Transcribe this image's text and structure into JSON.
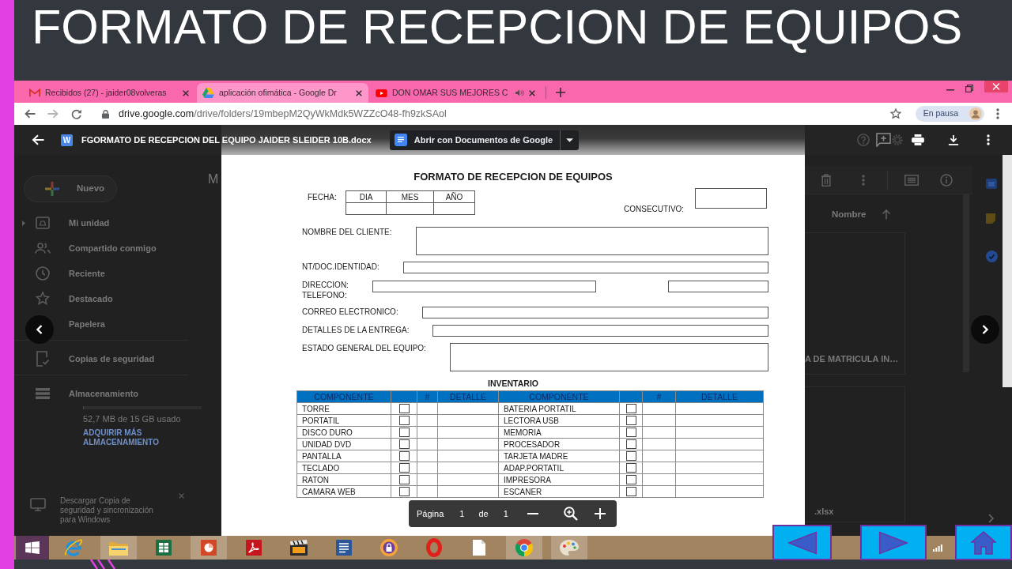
{
  "slide": {
    "title": "FORMATO DE RECEPCION DE EQUIPOS"
  },
  "browser": {
    "tabs": [
      {
        "kind": "mail",
        "title": "Recibidos (27) - jaider08volveras",
        "audio": false,
        "selected": false
      },
      {
        "kind": "drive",
        "title": "aplicación ofimática - Google Dr",
        "audio": false,
        "selected": true
      },
      {
        "kind": "video",
        "title": "DON OMAR SUS MEJORES C",
        "audio": true,
        "selected": false
      }
    ],
    "url_host": "drive.google.com",
    "url_path": "/drive/folders/19mbepM2QyWkMdk5WZZcO48-fh9zkSAol",
    "profile_status": "En pausa"
  },
  "viewer": {
    "file_badge": "W",
    "file_name": "FGORMATO DE RECEPCION DEL EQUIPO JAIDER SLEIDER 10B.docx",
    "open_with": "Abrir con Documentos de Google",
    "page_label": "Página",
    "page": "1",
    "of_label": "de",
    "page_count": "1"
  },
  "drive": {
    "new_button": "Nuevo",
    "nav": [
      [
        {
          "kind": "my-drive",
          "label": "Mi unidad",
          "expanded": false
        },
        {
          "kind": "shared",
          "label": "Compartido conmigo"
        },
        {
          "kind": "recent",
          "label": "Reciente"
        },
        {
          "kind": "starred",
          "label": "Destacado"
        },
        {
          "label": "Papelera"
        }
      ],
      [
        {
          "kind": "backup",
          "label": "Copias de seguridad"
        }
      ],
      [
        {
          "kind": "storage",
          "label": "Almacenamiento"
        }
      ]
    ],
    "storage": {
      "level": 0.0034,
      "usage": "52,7 MB de 15 GB usado",
      "upgrade": "ADQUIRIR MÁS ALMACENAMIENTO"
    },
    "promo": "Descargar Copia de seguridad y sincronización para Windows",
    "heading": "M",
    "sort_label": "Nombre",
    "files": [
      {
        "name": "A DE MATRICULA IN…"
      },
      {
        "name": ".xlsx"
      }
    ]
  },
  "document": {
    "title": "FORMATO DE RECEPCION DE EQUIPOS",
    "date": {
      "label": "FECHA:",
      "columns": [
        "DIA",
        "MES",
        "AÑO"
      ]
    },
    "serial": {
      "label": "CONSECUTIVO:"
    },
    "fields": [
      {
        "kind": "area",
        "label": "NOMBRE DEL CLIENTE:"
      },
      {
        "kind": "line",
        "label": "NT/DOC.IDENTIDAD:"
      },
      {
        "kind": "pair",
        "label": "DIRECCION:",
        "second_label": "TELEFONO:"
      },
      {
        "kind": "line",
        "label": "CORREO ELECTRONICO:"
      },
      {
        "kind": "line",
        "label": "DETALLES DE LA ENTREGA:"
      },
      {
        "kind": "area",
        "label": "ESTADO GENERAL DEL EQUIPO:"
      }
    ],
    "inventory": {
      "title": "INVENTARIO",
      "columns": [
        {
          "kind": "name",
          "label": "COMPONENTE"
        },
        {
          "kind": "check"
        },
        {
          "kind": "count",
          "label": "#"
        },
        {
          "kind": "detail",
          "label": "DETALLE"
        },
        {
          "kind": "name",
          "label": "COMPONENTE"
        },
        {
          "kind": "check"
        },
        {
          "kind": "count",
          "label": "#"
        },
        {
          "kind": "detail",
          "label": "DETALLE"
        }
      ],
      "rows": [
        [
          {
            "name": "TORRE",
            "checked": false
          },
          {
            "name": "BATERIA PORTATIL",
            "checked": false
          }
        ],
        [
          {
            "name": "PORTATIL",
            "checked": false
          },
          {
            "name": "LECTORA USB",
            "checked": false
          }
        ],
        [
          {
            "name": "DISCO DURO",
            "checked": false
          },
          {
            "name": "MEMORIA",
            "checked": false
          }
        ],
        [
          {
            "name": "UNIDAD DVD",
            "checked": false
          },
          {
            "name": "PROCESADOR",
            "checked": false
          }
        ],
        [
          {
            "name": "PANTALLA",
            "checked": false
          },
          {
            "name": "TARJETA MADRE",
            "checked": false
          }
        ],
        [
          {
            "name": "TECLADO",
            "checked": false
          },
          {
            "name": "ADAP.PORTATIL",
            "checked": false
          }
        ],
        [
          {
            "name": "RATON",
            "checked": false
          },
          {
            "name": "IMPRESORA",
            "checked": false
          }
        ],
        [
          {
            "name": "CAMARA WEB",
            "checked": false
          },
          {
            "name": "ESCANER",
            "checked": false
          }
        ]
      ]
    }
  },
  "taskbar": {
    "apps": [
      {
        "kind": "start",
        "running": false
      },
      {
        "kind": "globe-e",
        "running": false
      },
      {
        "kind": "folder",
        "running": true
      },
      {
        "kind": "sheet",
        "running": false
      },
      {
        "kind": "slides",
        "running": true
      },
      {
        "kind": "pdf",
        "running": false
      },
      {
        "kind": "media",
        "running": false
      },
      {
        "kind": "doc",
        "running": false
      },
      {
        "kind": "lock",
        "running": false
      },
      {
        "kind": "ring",
        "running": false
      },
      {
        "kind": "page",
        "running": false
      },
      {
        "kind": "wheel",
        "running": true
      },
      {
        "kind": "palette",
        "running": true
      }
    ]
  }
}
